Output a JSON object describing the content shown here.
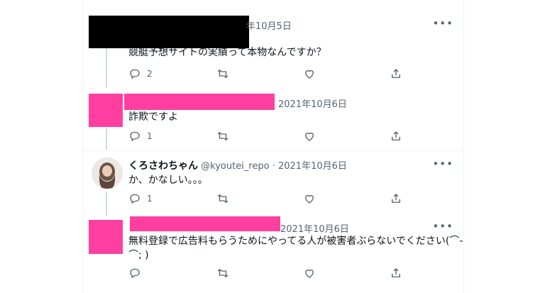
{
  "tweets": [
    {
      "date": "年10月5日",
      "text": "競艇予想サイトの実績って本物なんですか？",
      "replies": "2"
    },
    {
      "date": "2021年10月6日",
      "text": "詐欺ですよ",
      "replies": "1"
    },
    {
      "name": "くろさわちゃん",
      "handle": "@kyoutei_repo",
      "dot": "·",
      "date": "2021年10月6日",
      "text": "か、かなしい。。。",
      "replies": "1"
    },
    {
      "date": "2021年10月6日",
      "text_line1": "無料登録で広告料もらうためにやってる人が被害者ぶらないでください(⌒-",
      "text_line2": "⌒; )",
      "replies": ""
    }
  ],
  "ui": {
    "more_label": "•••"
  },
  "colors": {
    "redaction_pink": "#ff3fa0",
    "redaction_black": "#000000",
    "muted": "#536471"
  }
}
